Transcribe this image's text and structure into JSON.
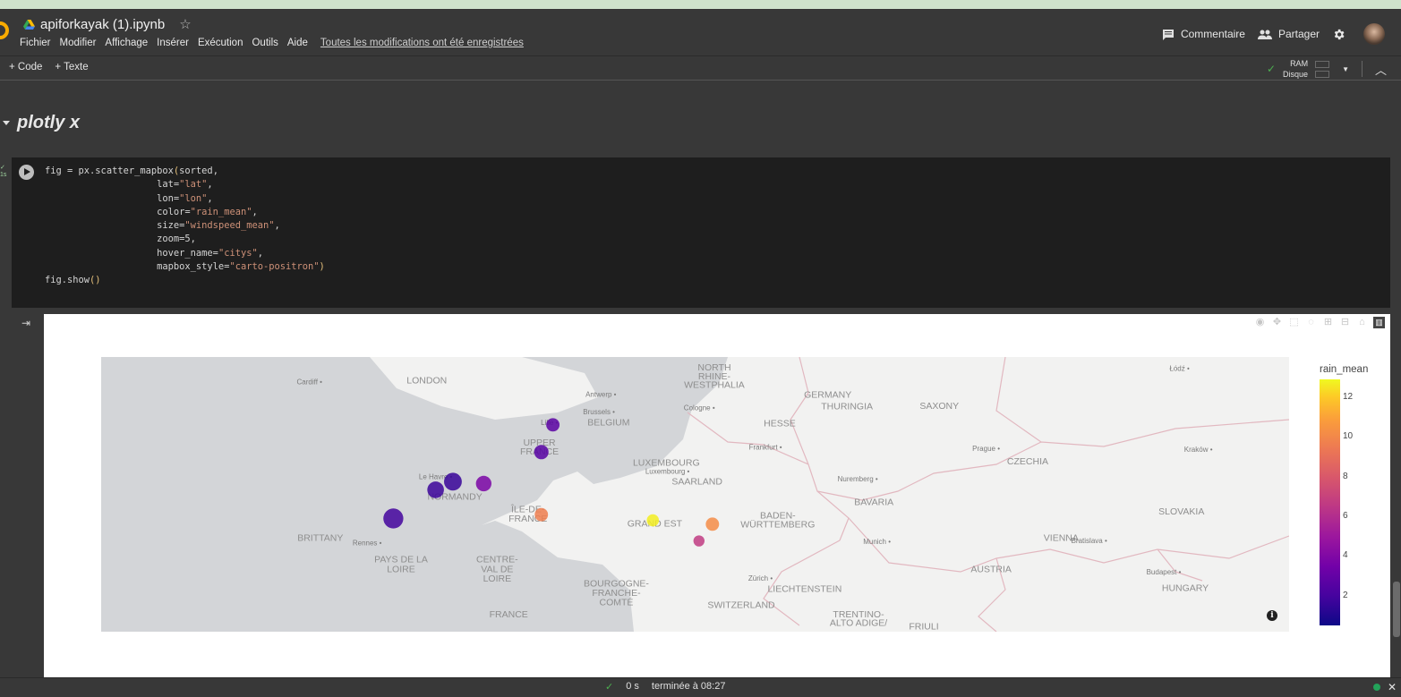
{
  "notebook": {
    "title": "apiforkayak (1).ipynb"
  },
  "menu": [
    "Fichier",
    "Modifier",
    "Affichage",
    "Insérer",
    "Exécution",
    "Outils",
    "Aide"
  ],
  "save_status": "Toutes les modifications ont été enregistrées",
  "header_actions": {
    "comment": "Commentaire",
    "share": "Partager"
  },
  "toolbar": {
    "add_code": "Code",
    "add_text": "Texte",
    "ram": "RAM",
    "disk": "Disque"
  },
  "section": {
    "title": "plotly x"
  },
  "code_lines": [
    [
      {
        "t": "fig = px.scatter_mapbox",
        "c": ""
      },
      {
        "t": "(",
        "c": "y"
      },
      {
        "t": "sorted,",
        "c": ""
      }
    ],
    [
      {
        "t": "                    lat=",
        "c": ""
      },
      {
        "t": "\"lat\"",
        "c": "s"
      },
      {
        "t": ",",
        "c": ""
      }
    ],
    [
      {
        "t": "                    lon=",
        "c": ""
      },
      {
        "t": "\"lon\"",
        "c": "s"
      },
      {
        "t": ",",
        "c": ""
      }
    ],
    [
      {
        "t": "                    color=",
        "c": ""
      },
      {
        "t": "\"rain_mean\"",
        "c": "s"
      },
      {
        "t": ",",
        "c": ""
      }
    ],
    [
      {
        "t": "                    size=",
        "c": ""
      },
      {
        "t": "\"windspeed_mean\"",
        "c": "s"
      },
      {
        "t": ",",
        "c": ""
      }
    ],
    [
      {
        "t": "                    zoom=5,",
        "c": ""
      }
    ],
    [
      {
        "t": "                    hover_name=",
        "c": ""
      },
      {
        "t": "\"citys\"",
        "c": "s"
      },
      {
        "t": ",",
        "c": ""
      }
    ],
    [
      {
        "t": "                    mapbox_style=",
        "c": ""
      },
      {
        "t": "\"carto-positron\"",
        "c": "s"
      },
      {
        "t": ")",
        "c": "y"
      }
    ],
    [
      {
        "t": "fig.show",
        "c": ""
      },
      {
        "t": "()",
        "c": "y"
      }
    ]
  ],
  "map_labels": [
    {
      "text": "Łódź",
      "big": false,
      "lon": 19.45,
      "lat": 51.76
    },
    {
      "text": "LONDON",
      "big": true,
      "lon": -0.13,
      "lat": 51.5
    },
    {
      "text": "Cardiff",
      "big": false,
      "lon": -3.18,
      "lat": 51.48
    },
    {
      "text": "NORTH",
      "big": true,
      "lon": 7.35,
      "lat": 51.77
    },
    {
      "text": "RHINE-",
      "big": true,
      "lon": 7.35,
      "lat": 51.58
    },
    {
      "text": "WESTPHALIA",
      "big": true,
      "lon": 7.35,
      "lat": 51.4
    },
    {
      "text": "Antwerp",
      "big": false,
      "lon": 4.4,
      "lat": 51.22
    },
    {
      "text": "GERMANY",
      "big": true,
      "lon": 10.3,
      "lat": 51.2
    },
    {
      "text": "THURINGIA",
      "big": true,
      "lon": 10.8,
      "lat": 50.95
    },
    {
      "text": "SAXONY",
      "big": true,
      "lon": 13.2,
      "lat": 50.96
    },
    {
      "text": "Cologne",
      "big": false,
      "lon": 6.96,
      "lat": 50.94
    },
    {
      "text": "Brussels",
      "big": false,
      "lon": 4.35,
      "lat": 50.85
    },
    {
      "text": "BELGIUM",
      "big": true,
      "lon": 4.6,
      "lat": 50.62
    },
    {
      "text": "Lille",
      "big": false,
      "lon": 3.06,
      "lat": 50.63
    },
    {
      "text": "HESSE",
      "big": true,
      "lon": 9.05,
      "lat": 50.6
    },
    {
      "text": "UPPER",
      "big": true,
      "lon": 2.8,
      "lat": 50.2
    },
    {
      "text": "FRANCE",
      "big": true,
      "lon": 2.8,
      "lat": 50.01
    },
    {
      "text": "Frankfurt",
      "big": false,
      "lon": 8.68,
      "lat": 50.11
    },
    {
      "text": "Prague",
      "big": false,
      "lon": 14.42,
      "lat": 50.08
    },
    {
      "text": "Kraków",
      "big": false,
      "lon": 19.94,
      "lat": 50.06
    },
    {
      "text": "LUXEMBOURG",
      "big": true,
      "lon": 6.1,
      "lat": 49.77
    },
    {
      "text": "Luxembourg",
      "big": false,
      "lon": 6.13,
      "lat": 49.61
    },
    {
      "text": "CZECHIA",
      "big": true,
      "lon": 15.5,
      "lat": 49.8
    },
    {
      "text": "Le Havre",
      "big": false,
      "lon": 0.1,
      "lat": 49.49
    },
    {
      "text": "SAARLAND",
      "big": true,
      "lon": 6.9,
      "lat": 49.38
    },
    {
      "text": "Nuremberg",
      "big": false,
      "lon": 11.08,
      "lat": 49.45
    },
    {
      "text": "NORMANDY",
      "big": true,
      "lon": 0.6,
      "lat": 49.06
    },
    {
      "text": "BAVARIA",
      "big": true,
      "lon": 11.5,
      "lat": 48.95
    },
    {
      "text": "ÎLE-DE-",
      "big": true,
      "lon": 2.5,
      "lat": 48.8
    },
    {
      "text": "FRANCE",
      "big": true,
      "lon": 2.5,
      "lat": 48.6
    },
    {
      "text": "SLOVAKIA",
      "big": true,
      "lon": 19.5,
      "lat": 48.75
    },
    {
      "text": "BADEN-",
      "big": true,
      "lon": 9.0,
      "lat": 48.67
    },
    {
      "text": "GRAND EST",
      "big": true,
      "lon": 5.8,
      "lat": 48.5
    },
    {
      "text": "WÜRTTEMBERG",
      "big": true,
      "lon": 9.0,
      "lat": 48.48
    },
    {
      "text": "BRITTANY",
      "big": true,
      "lon": -2.9,
      "lat": 48.2
    },
    {
      "text": "Rennes",
      "big": false,
      "lon": -1.68,
      "lat": 48.11
    },
    {
      "text": "Munich",
      "big": false,
      "lon": 11.58,
      "lat": 48.14
    },
    {
      "text": "VIENNA",
      "big": true,
      "lon": 16.37,
      "lat": 48.2
    },
    {
      "text": "Bratislava",
      "big": false,
      "lon": 17.1,
      "lat": 48.15
    },
    {
      "text": "PAYS DE LA",
      "big": true,
      "lon": -0.8,
      "lat": 47.75
    },
    {
      "text": "LOIRE",
      "big": true,
      "lon": -0.8,
      "lat": 47.55
    },
    {
      "text": "CENTRE-",
      "big": true,
      "lon": 1.7,
      "lat": 47.75
    },
    {
      "text": "VAL DE",
      "big": true,
      "lon": 1.7,
      "lat": 47.55
    },
    {
      "text": "LOIRE",
      "big": true,
      "lon": 1.7,
      "lat": 47.35
    },
    {
      "text": "AUSTRIA",
      "big": true,
      "lon": 14.55,
      "lat": 47.55
    },
    {
      "text": "Budapest",
      "big": false,
      "lon": 19.04,
      "lat": 47.5
    },
    {
      "text": "Zürich",
      "big": false,
      "lon": 8.55,
      "lat": 47.37
    },
    {
      "text": "HUNGARY",
      "big": true,
      "lon": 19.6,
      "lat": 47.15
    },
    {
      "text": "BOURGOGNE-",
      "big": true,
      "lon": 4.8,
      "lat": 47.25
    },
    {
      "text": "FRANCHE-",
      "big": true,
      "lon": 4.8,
      "lat": 47.05
    },
    {
      "text": "LIECHTENSTEIN",
      "big": true,
      "lon": 9.7,
      "lat": 47.13
    },
    {
      "text": "COMTÉ",
      "big": true,
      "lon": 4.8,
      "lat": 46.85
    },
    {
      "text": "SWITZERLAND",
      "big": true,
      "lon": 8.05,
      "lat": 46.8
    },
    {
      "text": "FRANCE",
      "big": true,
      "lon": 2.0,
      "lat": 46.6
    },
    {
      "text": "TRENTINO-",
      "big": true,
      "lon": 11.1,
      "lat": 46.6
    },
    {
      "text": "ALTO ADIGE/",
      "big": true,
      "lon": 11.1,
      "lat": 46.42
    },
    {
      "text": "FRIULI",
      "big": true,
      "lon": 12.8,
      "lat": 46.35
    }
  ],
  "chart_data": {
    "type": "scatter",
    "x_field": "lon",
    "y_field": "lat",
    "color_field": "rain_mean",
    "size_field": "windspeed_mean",
    "points": [
      {
        "lon": 3.15,
        "lat": 50.63,
        "rain_mean": 2.5,
        "windspeed_mean": 12
      },
      {
        "lon": 2.85,
        "lat": 50.06,
        "rain_mean": 2.4,
        "windspeed_mean": 13
      },
      {
        "lon": 0.55,
        "lat": 49.44,
        "rain_mean": 1.5,
        "windspeed_mean": 16
      },
      {
        "lon": 1.35,
        "lat": 49.4,
        "rain_mean": 3.5,
        "windspeed_mean": 14
      },
      {
        "lon": 0.1,
        "lat": 49.27,
        "rain_mean": 1.6,
        "windspeed_mean": 15
      },
      {
        "lon": -1.0,
        "lat": 48.67,
        "rain_mean": 1.8,
        "windspeed_mean": 18
      },
      {
        "lon": 2.85,
        "lat": 48.75,
        "rain_mean": 9.0,
        "windspeed_mean": 12
      },
      {
        "lon": 5.75,
        "lat": 48.63,
        "rain_mean": 12.6,
        "windspeed_mean": 11
      },
      {
        "lon": 7.3,
        "lat": 48.55,
        "rain_mean": 9.5,
        "windspeed_mean": 12
      },
      {
        "lon": 6.95,
        "lat": 48.2,
        "rain_mean": 6.2,
        "windspeed_mean": 10
      }
    ],
    "colorbar": {
      "title": "rain_mean",
      "ticks": [
        2,
        4,
        6,
        8,
        10,
        12
      ],
      "range": [
        0.5,
        12.9
      ]
    }
  },
  "status": {
    "duration": "0 s",
    "finished": "terminée à 08:27"
  }
}
